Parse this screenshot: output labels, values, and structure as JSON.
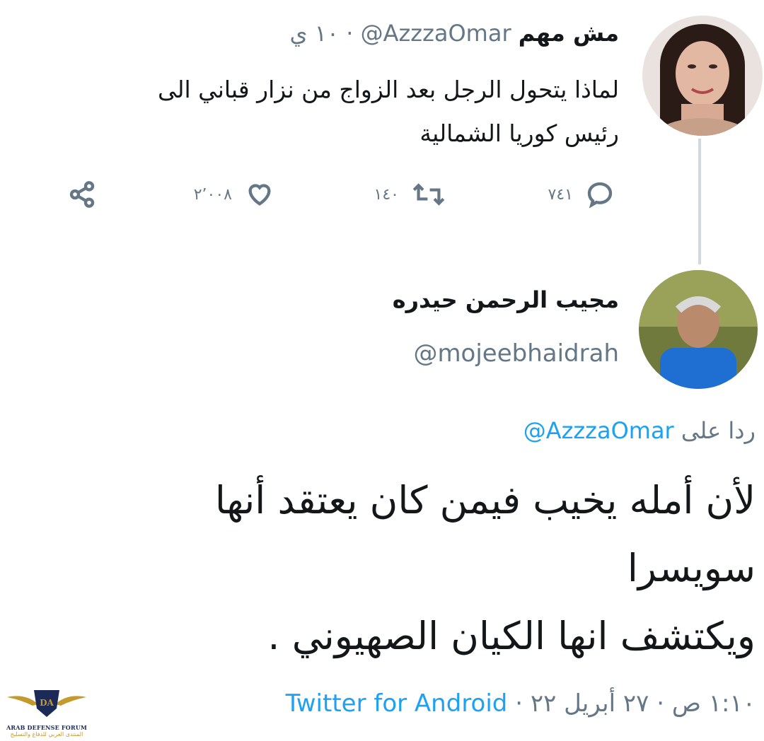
{
  "original_tweet": {
    "author_name": "مش مهم",
    "author_handle": "@AzzzaOmar",
    "separator": "·",
    "time": "١٠ ي",
    "text_line1": "لماذا يتحول الرجل بعد الزواج من نزار قباني الى",
    "text_line2": "رئيس كوريا الشمالية",
    "actions": {
      "reply_count": "٧٤١",
      "retweet_count": "١٤٠",
      "like_count": "٢٬٠٠٨"
    }
  },
  "reply_tweet": {
    "author_name": "مجيب الرحمن حيدره",
    "author_handle": "@mojeebhaidrah",
    "replying_to_prefix": "ردا على",
    "replying_to_handle": "@AzzzaOmar",
    "text": "لأن أمله يخيب فيمن كان يعتقد أنها\nسويسرا\nويكتشف انها الكيان الصهيوني .",
    "time": "١:١٠ ص",
    "date": "٢٧ أبريل ٢٢",
    "source": "Twitter for Android",
    "separator": "·"
  },
  "watermark": {
    "logo_text": "DA",
    "title": "ARAB DEFENSE FORUM",
    "subtitle": "المنتدى العربي للدفاع والتسليح"
  },
  "colors": {
    "link": "#1da1f2",
    "muted": "#657786",
    "text": "#14171a",
    "thread_line": "#cfd9de"
  }
}
